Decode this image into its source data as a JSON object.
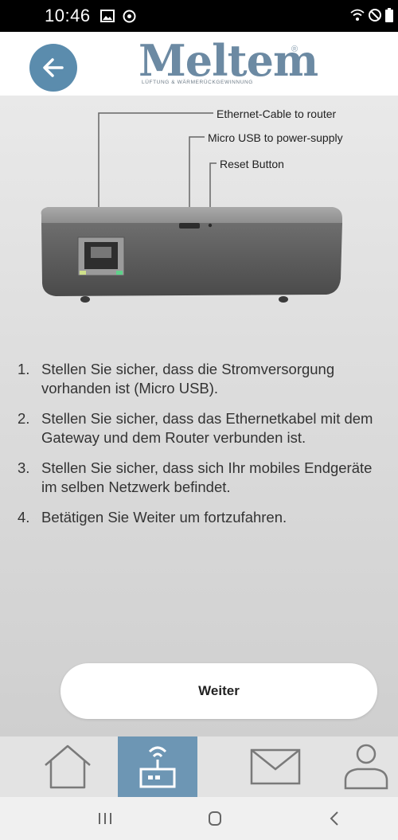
{
  "status_bar": {
    "time": "10:46",
    "icons_left": [
      "image-icon",
      "messenger-icon"
    ],
    "icons_right": [
      "wifi-icon",
      "do-not-disturb-icon",
      "battery-icon"
    ]
  },
  "header": {
    "logo_text": "Meltem",
    "logo_registered": "®",
    "logo_subtitle": "LÜFTUNG & WÄRMERÜCKGEWINNUNG",
    "back_icon": "arrow-left-icon"
  },
  "diagram": {
    "labels": [
      "Ethernet-Cable to router",
      "Micro USB to power-supply",
      "Reset Button"
    ]
  },
  "instructions": [
    {
      "number": "1.",
      "text": "Stellen Sie sicher, dass die Stromversorgung vorhanden ist (Micro USB)."
    },
    {
      "number": "2.",
      "text": "Stellen Sie sicher, dass das Ethernetkabel mit dem Gateway und dem Router verbunden ist."
    },
    {
      "number": "3.",
      "text": "Stellen Sie sicher, dass sich Ihr mobiles Endgeräte im selben Netzwerk befindet."
    },
    {
      "number": "4.",
      "text": "Betätigen Sie Weiter um fortzufahren."
    }
  ],
  "weiter_label": "Weiter",
  "tab_bar": {
    "tabs": [
      {
        "icon": "home-icon",
        "active": false
      },
      {
        "icon": "gateway-icon",
        "active": true
      },
      {
        "icon": "mail-icon",
        "active": false
      },
      {
        "icon": "person-icon",
        "active": false
      }
    ]
  },
  "colors": {
    "accent": "#6d96b4",
    "back_button": "#5b8cad",
    "logo": "#6c8aa3"
  },
  "nav_bar": {
    "buttons": [
      "recent-apps-icon",
      "home-nav-icon",
      "back-nav-icon"
    ]
  }
}
